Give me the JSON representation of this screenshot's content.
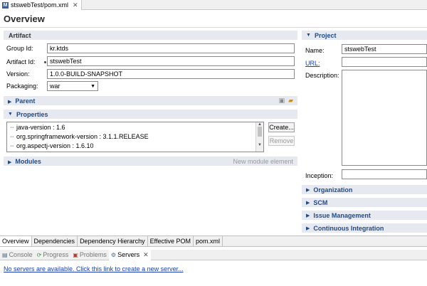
{
  "editor_tab": {
    "icon": "maven-pom-icon",
    "label": "stswebTest/pom.xml"
  },
  "page_title": "Overview",
  "artifact": {
    "header": "Artifact",
    "group_id_label": "Group Id:",
    "group_id": "kr.ktds",
    "artifact_id_label": "Artifact Id:",
    "artifact_id": "stswebTest",
    "version_label": "Version:",
    "version": "1.0.0-BUILD-SNAPSHOT",
    "packaging_label": "Packaging:",
    "packaging": "war"
  },
  "parent": {
    "header": "Parent"
  },
  "properties": {
    "header": "Properties",
    "items": [
      "java-version : 1.6",
      "org.springframework-version : 3.1.1.RELEASE",
      "org.aspectj-version : 1.6.10"
    ],
    "create_label": "Create...",
    "remove_label": "Remove"
  },
  "modules": {
    "header": "Modules",
    "new_module_label": "New module element"
  },
  "project": {
    "header": "Project",
    "name_label": "Name:",
    "name": "stswebTest",
    "url_label": "URL:",
    "url": "",
    "description_label": "Description:",
    "description": "",
    "inception_label": "Inception:",
    "inception": ""
  },
  "right_sections": [
    "Organization",
    "SCM",
    "Issue Management",
    "Continuous Integration"
  ],
  "editor_tabs": [
    "Overview",
    "Dependencies",
    "Dependency Hierarchy",
    "Effective POM",
    "pom.xml"
  ],
  "view_tabs": [
    {
      "icon": "console-icon",
      "label": "Console"
    },
    {
      "icon": "progress-icon",
      "label": "Progress"
    },
    {
      "icon": "problems-icon",
      "label": "Problems"
    },
    {
      "icon": "servers-icon",
      "label": "Servers"
    }
  ],
  "servers_message": "No servers are available. Click this link to create a new server..."
}
